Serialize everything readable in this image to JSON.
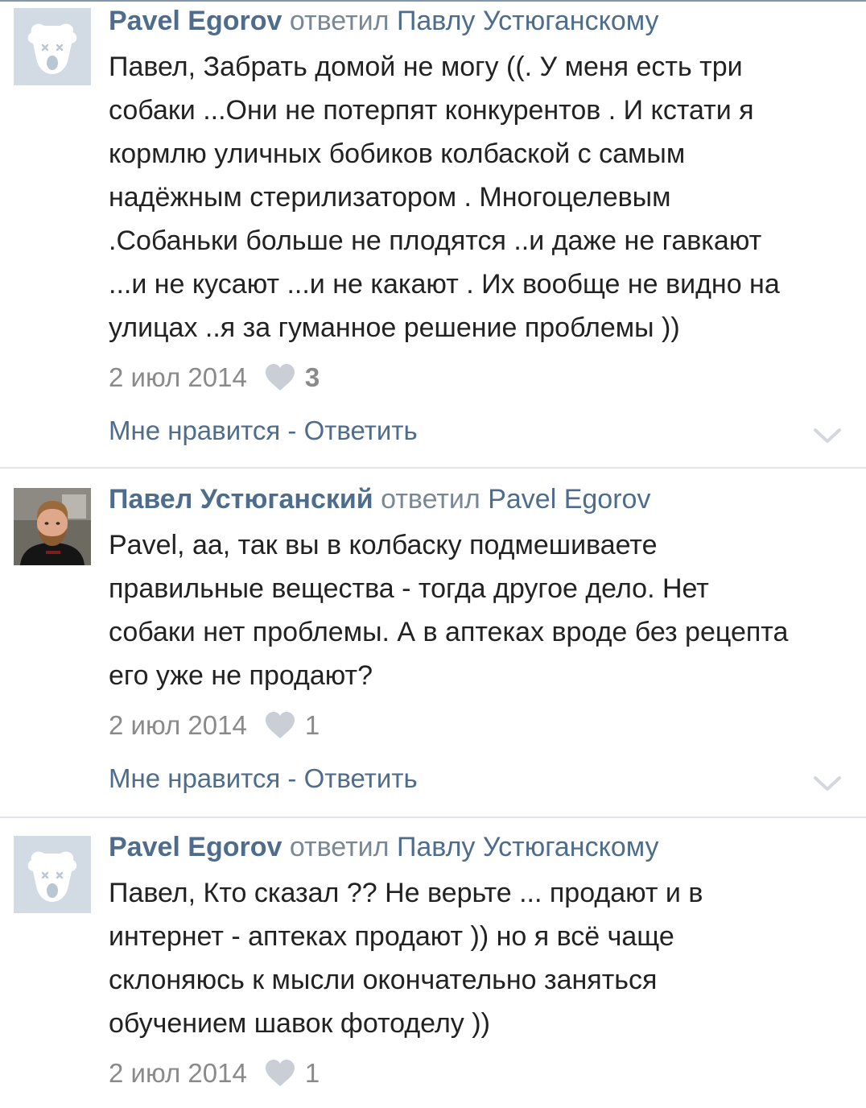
{
  "comments": [
    {
      "author": "Pavel Egorov",
      "replied": "ответил",
      "target": "Павлу Устюганскому",
      "lines": [
        "Павел, Забрать домой не могу ((. У меня есть три",
        "собаки ...Они не потерпят конкурентов . И кстати я",
        "кормлю уличных бобиков колбаской с самым",
        "надёжным стерилизатором . Многоцелевым",
        ".Собаньки больше не плодятся ..и даже не гавкают",
        "...и не кусают ...и не какают . Их вообще не видно на",
        "улицах ..я за гуманное решение проблемы ))"
      ],
      "date": "2 июл 2014",
      "likes": "3",
      "like_label": "Мне нравится",
      "separator": " - ",
      "reply_label": "Ответить",
      "avatar_icon": "deactivated-dog-icon"
    },
    {
      "author": "Павел Устюганский",
      "replied": "ответил",
      "target": "Pavel Egorov",
      "lines": [
        "Pavel, аа, так вы в колбаску подмешиваете",
        "правильные вещества - тогда другое дело. Нет",
        "собаки нет проблемы. А в аптеках вроде без рецепта",
        "его уже не продают?"
      ],
      "date": "2 июл 2014",
      "likes": "1",
      "like_label": "Мне нравится",
      "separator": " - ",
      "reply_label": "Ответить",
      "avatar_icon": "user-photo"
    },
    {
      "author": "Pavel Egorov",
      "replied": "ответил",
      "target": "Павлу Устюганскому",
      "lines": [
        "Павел, Кто сказал ?? Не верьте ... продают и в",
        "интернет - аптеках продают )) но я всё чаще",
        "склоняюсь к мысли окончательно заняться",
        "обучением шавок фотоделу ))"
      ],
      "date": "2 июл 2014",
      "likes": "1",
      "avatar_icon": "deactivated-dog-icon"
    }
  ],
  "colors": {
    "link": "#4e6d8d",
    "meta": "#8a8a8a",
    "text": "#222222",
    "avatar_bg": "#d2dbe4"
  }
}
